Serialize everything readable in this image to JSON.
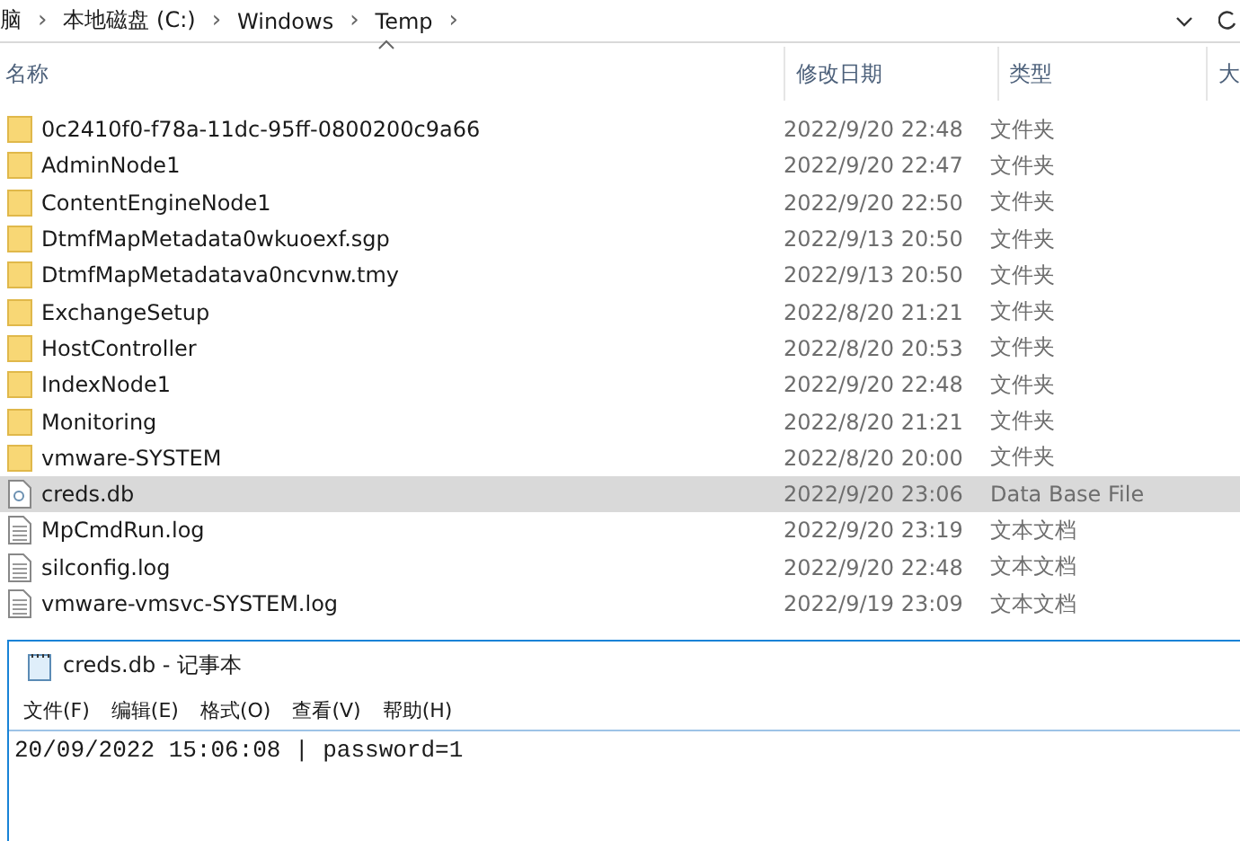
{
  "address_bar": {
    "crumbs": [
      "脑",
      "本地磁盘 (C:)",
      "Windows",
      "Temp"
    ],
    "separator": "›"
  },
  "columns": [
    "名称",
    "修改日期",
    "类型",
    "大"
  ],
  "files": [
    {
      "kind": "folder",
      "name": "0c2410f0-f78a-11dc-95ff-0800200c9a66",
      "modified": "2022/9/20 22:48",
      "type": "文件夹",
      "selected": false
    },
    {
      "kind": "folder",
      "name": "AdminNode1",
      "modified": "2022/9/20 22:47",
      "type": "文件夹",
      "selected": false
    },
    {
      "kind": "folder",
      "name": "ContentEngineNode1",
      "modified": "2022/9/20 22:50",
      "type": "文件夹",
      "selected": false
    },
    {
      "kind": "folder",
      "name": "DtmfMapMetadata0wkuoexf.sgp",
      "modified": "2022/9/13 20:50",
      "type": "文件夹",
      "selected": false
    },
    {
      "kind": "folder",
      "name": "DtmfMapMetadatava0ncvnw.tmy",
      "modified": "2022/9/13 20:50",
      "type": "文件夹",
      "selected": false
    },
    {
      "kind": "folder",
      "name": "ExchangeSetup",
      "modified": "2022/8/20 21:21",
      "type": "文件夹",
      "selected": false
    },
    {
      "kind": "folder",
      "name": "HostController",
      "modified": "2022/8/20 20:53",
      "type": "文件夹",
      "selected": false
    },
    {
      "kind": "folder",
      "name": "IndexNode1",
      "modified": "2022/9/20 22:48",
      "type": "文件夹",
      "selected": false
    },
    {
      "kind": "folder",
      "name": "Monitoring",
      "modified": "2022/8/20 21:21",
      "type": "文件夹",
      "selected": false
    },
    {
      "kind": "folder",
      "name": "vmware-SYSTEM",
      "modified": "2022/8/20 20:00",
      "type": "文件夹",
      "selected": false
    },
    {
      "kind": "db",
      "name": "creds.db",
      "modified": "2022/9/20 23:06",
      "type": "Data Base File",
      "selected": true
    },
    {
      "kind": "text",
      "name": "MpCmdRun.log",
      "modified": "2022/9/20 23:19",
      "type": "文本文档",
      "selected": false
    },
    {
      "kind": "text",
      "name": "silconfig.log",
      "modified": "2022/9/20 22:48",
      "type": "文本文档",
      "selected": false
    },
    {
      "kind": "text",
      "name": "vmware-vmsvc-SYSTEM.log",
      "modified": "2022/9/19 23:09",
      "type": "文本文档",
      "selected": false
    }
  ],
  "notepad": {
    "title": "creds.db - 记事本",
    "menu": [
      "文件(F)",
      "编辑(E)",
      "格式(O)",
      "查看(V)",
      "帮助(H)"
    ],
    "content": "20/09/2022 15:06:08 | password=1"
  }
}
